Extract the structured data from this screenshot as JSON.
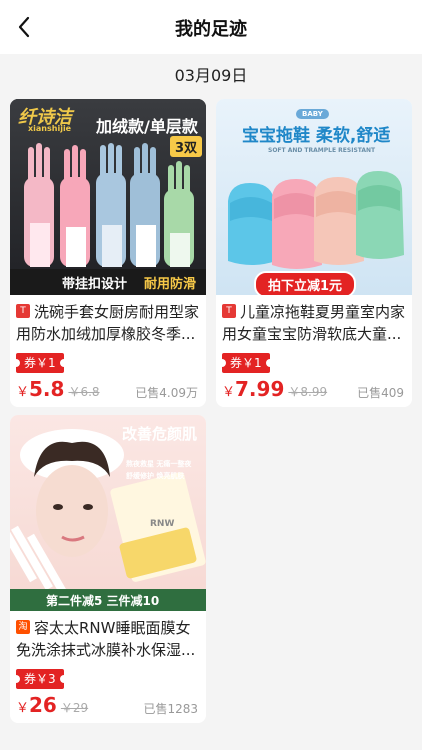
{
  "header": {
    "title": "我的足迹",
    "back_icon": "chevron-left-icon"
  },
  "date_label": "03月09日",
  "products": [
    {
      "platform": "天猫",
      "title": "洗碗手套女厨房耐用型家用防水加绒加厚橡胶冬季...",
      "coupon": "券￥1",
      "currency": "￥",
      "price": "5.8",
      "original_price": "￥6.8",
      "sold": "已售4.09万",
      "image": {
        "brand": "纤诗洁",
        "brand_en": "xianshijie",
        "badge": "加绒款/单层款",
        "count": "3双",
        "banner_left": "带挂扣设计",
        "banner_right": "耐用防滑"
      }
    },
    {
      "platform": "天猫",
      "title": "儿童凉拖鞋夏男童室内家用女童宝宝防滑软底大童...",
      "coupon": "券￥1",
      "currency": "￥",
      "price": "7.99",
      "original_price": "￥8.99",
      "sold": "已售409",
      "image": {
        "tag": "BABY",
        "headline": "宝宝拖鞋 柔软,舒适",
        "sub": "SOFT AND TRAMPLE RESISTANT",
        "banner": "拍下立减1元"
      }
    },
    {
      "platform": "淘",
      "title": "容太太RNW睡眠面膜女免洗涂抹式冰膜补水保湿...",
      "coupon": "券￥3",
      "currency": "￥",
      "price": "26",
      "original_price": "￥29",
      "sold": "已售1283",
      "image": {
        "headline": "改善危颜肌",
        "line1": "熬夜救星 无痛一整夜",
        "line2": "舒缓修护 焕亮肌肤",
        "pack_brand": "RNW",
        "banner": "第二件减5 三件减10"
      }
    }
  ],
  "colors": {
    "accent": "#e32323",
    "background": "#f4f4f4"
  }
}
